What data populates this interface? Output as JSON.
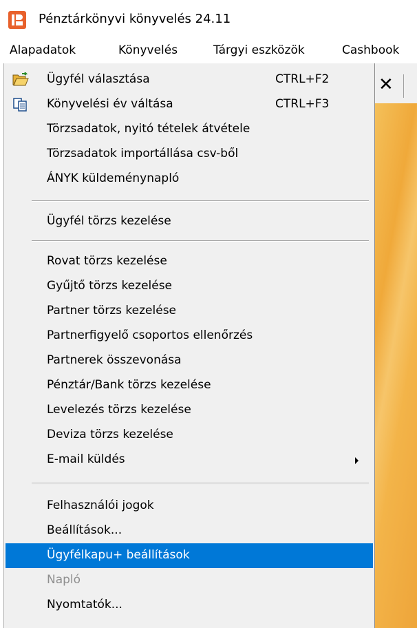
{
  "window": {
    "title": "Pénztárkönyvi könyvelés 24.11",
    "icon": "app-logo-icon"
  },
  "menubar": {
    "items": [
      "Alapadatok",
      "Könyvelés",
      "Tárgyi eszközök",
      "Cashbook"
    ]
  },
  "toolbar": {
    "close_glyph": "✕"
  },
  "dropdown": {
    "items": [
      {
        "label": "Ügyfél választása",
        "shortcut": "CTRL+F2",
        "icon": "open-folder-icon"
      },
      {
        "label": "Könyvelési év váltása",
        "shortcut": "CTRL+F3",
        "icon": "copy-pages-icon"
      },
      {
        "label": "Törzsadatok, nyitó tételek átvétele"
      },
      {
        "label": "Törzsadatok importállása csv-ből"
      },
      {
        "label": "ÁNYK küldeménynapló"
      },
      {
        "label": "Ügyfél törzs kezelése"
      },
      {
        "label": "Rovat törzs kezelése"
      },
      {
        "label": "Gyűjtő törzs kezelése"
      },
      {
        "label": "Partner törzs kezelése"
      },
      {
        "label": "Partnerfigyelő csoportos ellenőrzés"
      },
      {
        "label": "Partnerek összevonása"
      },
      {
        "label": "Pénztár/Bank törzs kezelése"
      },
      {
        "label": "Levelezés törzs kezelése"
      },
      {
        "label": "Deviza törzs kezelése"
      },
      {
        "label": "E-mail küldés",
        "submenu": true
      },
      {
        "label": "Felhasználói jogok"
      },
      {
        "label": "Beállítások..."
      },
      {
        "label": "Ügyfélkapu+ beállítások",
        "highlighted": true
      },
      {
        "label": "Napló",
        "disabled": true
      },
      {
        "label": "Nyomtatók..."
      }
    ]
  },
  "colors": {
    "highlight": "#0078d7",
    "menu_bg": "#f0f0f0",
    "disabled_text": "#8f8f8f",
    "app_icon": "#e8612c"
  }
}
